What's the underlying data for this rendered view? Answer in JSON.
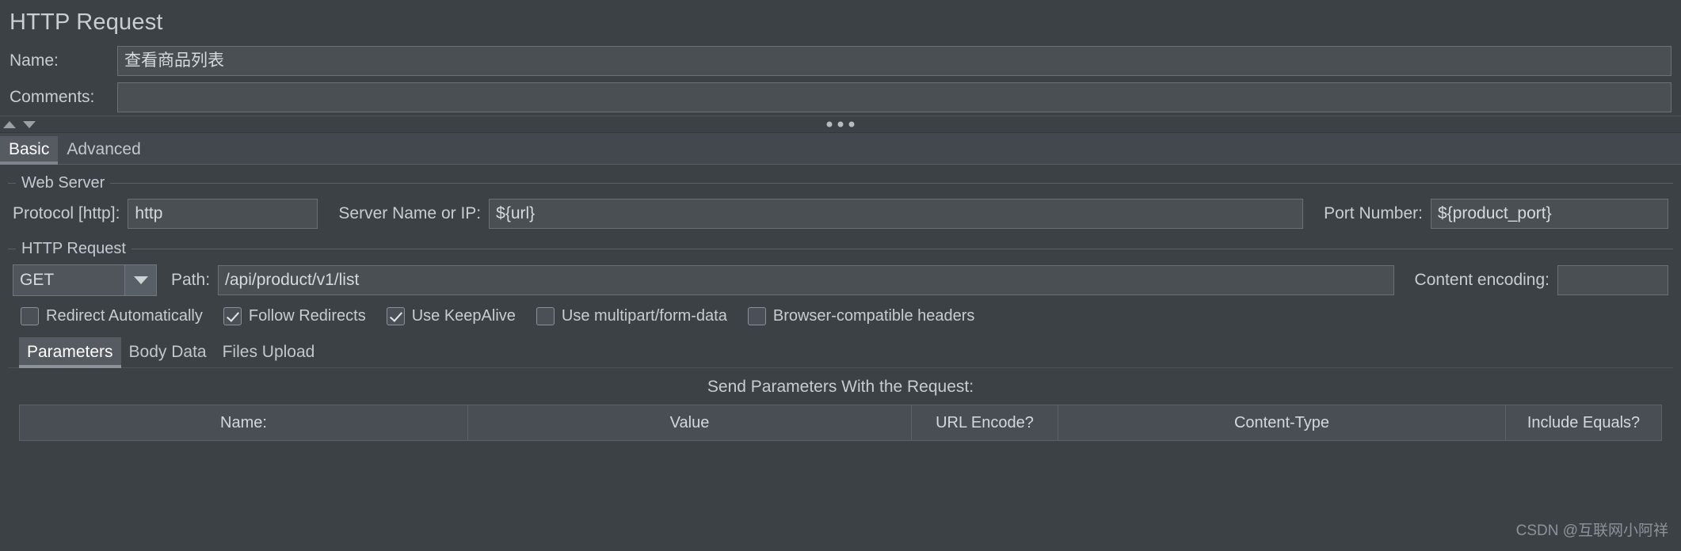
{
  "panel": {
    "title": "HTTP Request"
  },
  "fields": {
    "name_label": "Name:",
    "name_value": "查看商品列表",
    "comments_label": "Comments:",
    "comments_value": ""
  },
  "splitter": {
    "up_icon": "triangle-up-icon",
    "down_icon": "triangle-down-icon",
    "grip_icon": "three-dots-icon"
  },
  "top_tabs": [
    {
      "label": "Basic",
      "selected": true
    },
    {
      "label": "Advanced",
      "selected": false
    }
  ],
  "web_server": {
    "group_title": "Web Server",
    "protocol_label": "Protocol [http]:",
    "protocol_value": "http",
    "server_label": "Server Name or IP:",
    "server_value": "${url}",
    "port_label": "Port Number:",
    "port_value": "${product_port}"
  },
  "http_request": {
    "group_title": "HTTP Request",
    "method_value": "GET",
    "method_arrow_icon": "chevron-down-icon",
    "path_label": "Path:",
    "path_value": "/api/product/v1/list",
    "content_encoding_label": "Content encoding:",
    "content_encoding_value": ""
  },
  "checkboxes": [
    {
      "label": "Redirect Automatically",
      "checked": false
    },
    {
      "label": "Follow Redirects",
      "checked": true
    },
    {
      "label": "Use KeepAlive",
      "checked": true
    },
    {
      "label": "Use multipart/form-data",
      "checked": false
    },
    {
      "label": "Browser-compatible headers",
      "checked": false
    }
  ],
  "bottom_tabs": [
    {
      "label": "Parameters",
      "selected": true
    },
    {
      "label": "Body Data",
      "selected": false
    },
    {
      "label": "Files Upload",
      "selected": false
    }
  ],
  "params": {
    "caption": "Send Parameters With the Request:",
    "columns": [
      "Name:",
      "Value",
      "URL Encode?",
      "Content-Type",
      "Include Equals?"
    ],
    "rows": []
  },
  "watermark": {
    "text": "CSDN @互联网小阿祥"
  },
  "colors": {
    "background": "#3c4146",
    "field_background": "#4a4f54",
    "field_border": "#6a7075",
    "text": "#c8cdd2",
    "tab_selected_background": "#555b61"
  }
}
